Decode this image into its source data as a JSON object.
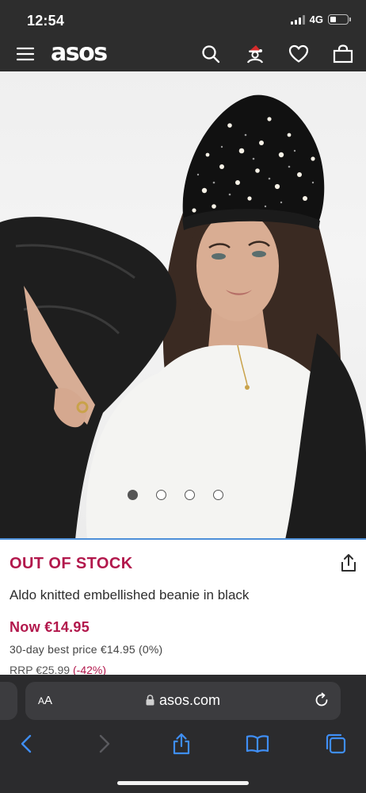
{
  "status_bar": {
    "time": "12:54",
    "network": "4G",
    "battery_level": 0.35
  },
  "header": {
    "logo": "asos",
    "icons": [
      "menu-icon",
      "search-icon",
      "account-icon",
      "heart-icon",
      "bag-icon"
    ]
  },
  "gallery": {
    "image_count": 4,
    "active_index": 0
  },
  "product": {
    "stock_status": "OUT OF STOCK",
    "name": "Aldo knitted embellished beanie in black",
    "price_now": "Now €14.95",
    "best_price_note": "30-day best price €14.95 (0%)",
    "rrp": "RRP €25.99",
    "discount": "(-42%)"
  },
  "browser": {
    "aa_label": "AA",
    "url": "asos.com",
    "toolbar_icons": [
      "back-icon",
      "forward-icon",
      "share-icon",
      "bookmarks-icon",
      "tabs-icon"
    ]
  },
  "colors": {
    "brand_dark": "#2d2d2d",
    "sale_red": "#b2184c",
    "accent_blue": "#4d8fd8",
    "browser_bg": "#2b2b2d"
  }
}
